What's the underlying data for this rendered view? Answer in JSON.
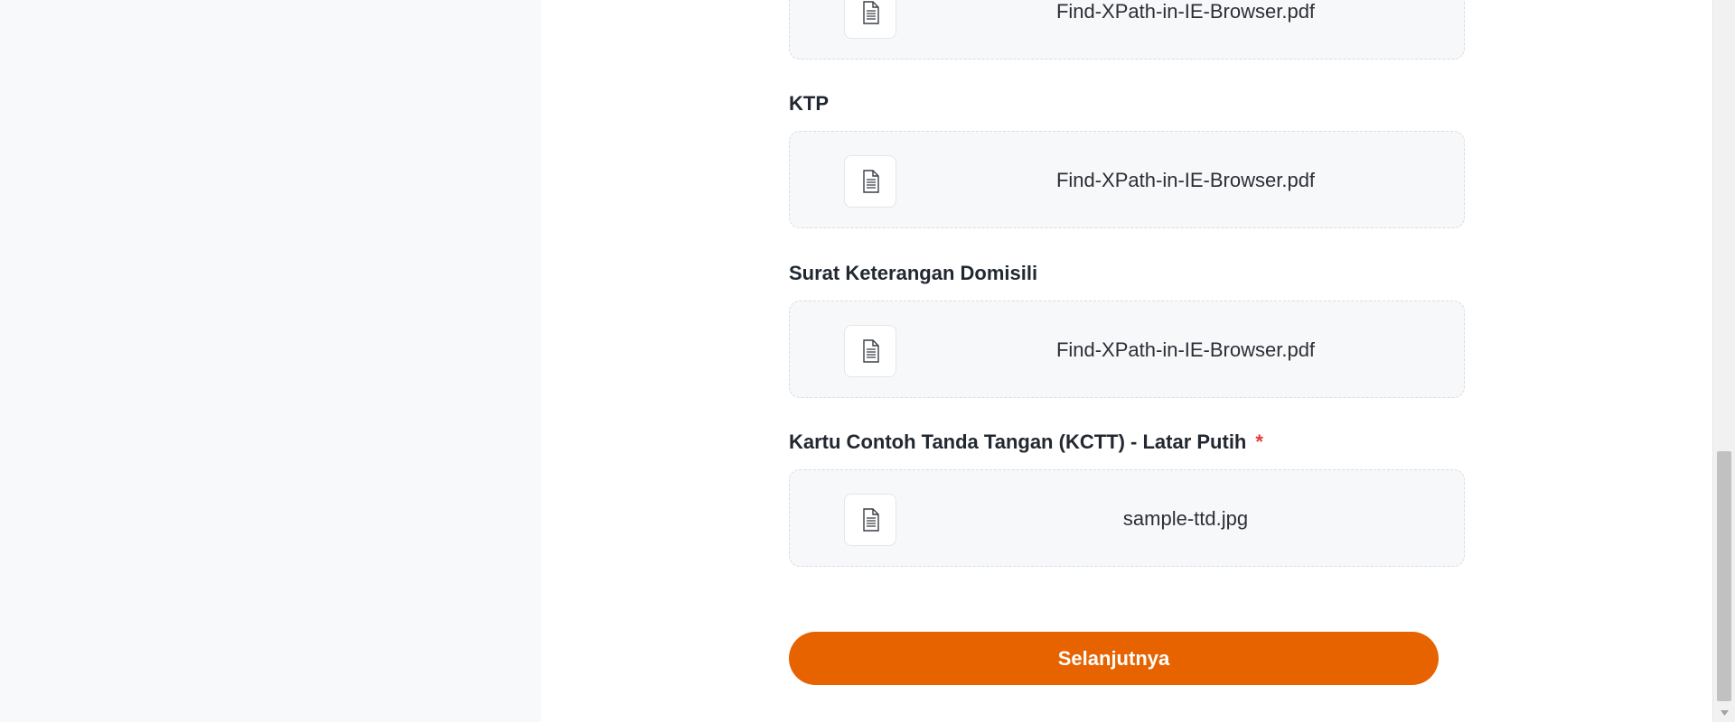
{
  "uploads": [
    {
      "label": "",
      "file_name": "Find-XPath-in-IE-Browser.pdf",
      "icon": "document-icon"
    },
    {
      "label": "KTP",
      "file_name": "Find-XPath-in-IE-Browser.pdf",
      "icon": "document-icon"
    },
    {
      "label": "Surat Keterangan Domisili",
      "file_name": "Find-XPath-in-IE-Browser.pdf",
      "icon": "document-icon"
    },
    {
      "label": "Kartu Contoh Tanda Tangan (KCTT) - Latar Putih",
      "required_mark": "*",
      "file_name": "sample-ttd.jpg",
      "icon": "document-icon"
    }
  ],
  "actions": {
    "next_label": "Selanjutnya"
  },
  "colors": {
    "accent": "#e66300",
    "required": "#e53935"
  }
}
